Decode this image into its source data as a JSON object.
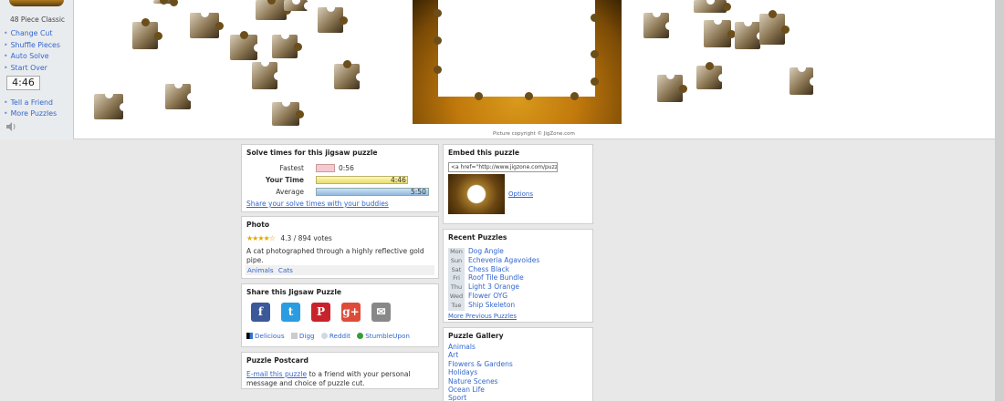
{
  "sidebar": {
    "piece_info": "48 Piece Classic",
    "menu": [
      "Change Cut",
      "Shuffle Pieces",
      "Auto Solve",
      "Start Over"
    ],
    "timer": "4:46",
    "menu2": [
      "Tell a Friend",
      "More Puzzles"
    ]
  },
  "copyright": "Picture copyright © JigZone.com",
  "solve_times": {
    "title": "Solve times for this jigsaw puzzle",
    "rows": [
      {
        "label": "Fastest",
        "value": "0:56",
        "fraction": 0.2
      },
      {
        "label": "Your Time",
        "value": "4:46",
        "fraction": 0.85
      },
      {
        "label": "Average",
        "value": "5:50",
        "fraction": 1.0
      }
    ],
    "share_link": "Share your solve times with your buddies"
  },
  "photo": {
    "title": "Photo",
    "stars": "★★★★☆",
    "rating": "4.3 / 894 votes",
    "description": "A cat photographed through a highly reflective gold pipe.",
    "tags": [
      "Animals",
      "Cats"
    ]
  },
  "share": {
    "title": "Share this Jigsaw Puzzle",
    "icons": [
      {
        "name": "facebook-icon",
        "glyph": "f",
        "color": "#3b5998"
      },
      {
        "name": "twitter-icon",
        "glyph": "t",
        "color": "#2b9ce0"
      },
      {
        "name": "pinterest-icon",
        "glyph": "P",
        "color": "#c8232c"
      },
      {
        "name": "googleplus-icon",
        "glyph": "g+",
        "color": "#dd4b39"
      },
      {
        "name": "email-icon",
        "glyph": "✉",
        "color": "#888888"
      }
    ],
    "bookmarks": [
      "Delicious",
      "Digg",
      "Reddit",
      "StumbleUpon"
    ]
  },
  "postcard": {
    "title": "Puzzle Postcard",
    "link": "E-mail this puzzle",
    "text": " to a friend with your personal message and choice of puzzle cut."
  },
  "embed": {
    "title": "Embed this puzzle",
    "code": "<a href=\"http://www.jigzone.com/puzzles",
    "options": "Options"
  },
  "recent": {
    "title": "Recent Puzzles",
    "items": [
      {
        "day": "Mon",
        "name": "Dog Angle"
      },
      {
        "day": "Sun",
        "name": "Echeveria Agavoides"
      },
      {
        "day": "Sat",
        "name": "Chess Black"
      },
      {
        "day": "Fri",
        "name": "Roof Tile Bundle"
      },
      {
        "day": "Thu",
        "name": "Light 3 Orange"
      },
      {
        "day": "Wed",
        "name": "Flower OYG"
      },
      {
        "day": "Tue",
        "name": "Ship Skeleton"
      }
    ],
    "more": "More Previous Puzzles"
  },
  "gallery": {
    "title": "Puzzle Gallery",
    "items": [
      "Animals",
      "Art",
      "Flowers & Gardens",
      "Holidays",
      "Nature Scenes",
      "Ocean Life",
      "Sport"
    ]
  }
}
